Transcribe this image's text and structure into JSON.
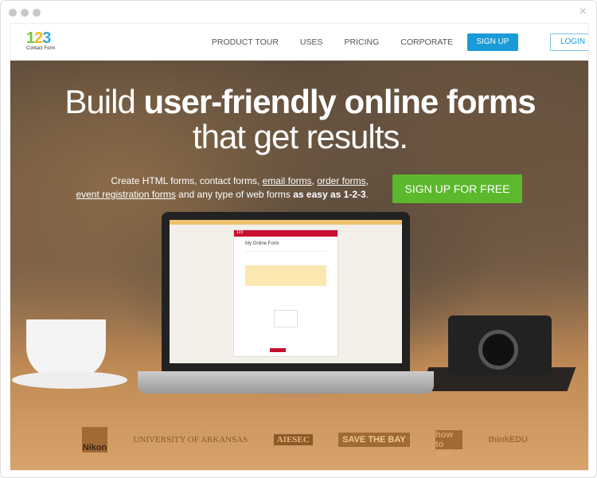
{
  "window": {
    "close_icon": "×"
  },
  "nav": {
    "logo_number": "123",
    "logo_text": "Contact Form",
    "links": [
      "PRODUCT TOUR",
      "USES",
      "PRICING",
      "CORPORATE"
    ],
    "signup": "SIGN UP",
    "login": "LOGIN"
  },
  "hero": {
    "headline_pre": "Build ",
    "headline_bold": "user-friendly online forms",
    "headline_line2": "that get results.",
    "sub_1": "Create HTML forms, contact forms, ",
    "link_email": "email forms",
    "sep1": ", ",
    "link_order": "order forms",
    "sep2": ",",
    "link_event": "event registration forms",
    "sub_2": " and any type of web forms ",
    "sub_bold": "as easy as 1-2-3",
    "sub_end": ".",
    "cta": "SIGN UP FOR FREE"
  },
  "form_preview": {
    "brand": "123",
    "title": "My Online Form"
  },
  "clients": [
    "Nikon",
    "UNIVERSITY OF ARKANSAS",
    "AIESEC",
    "SAVE THE BAY",
    "how to web",
    "thinkEDU"
  ],
  "colors": {
    "signup": "#1a9ad6",
    "cta": "#5cb82c",
    "form_bar": "#c8102e"
  }
}
